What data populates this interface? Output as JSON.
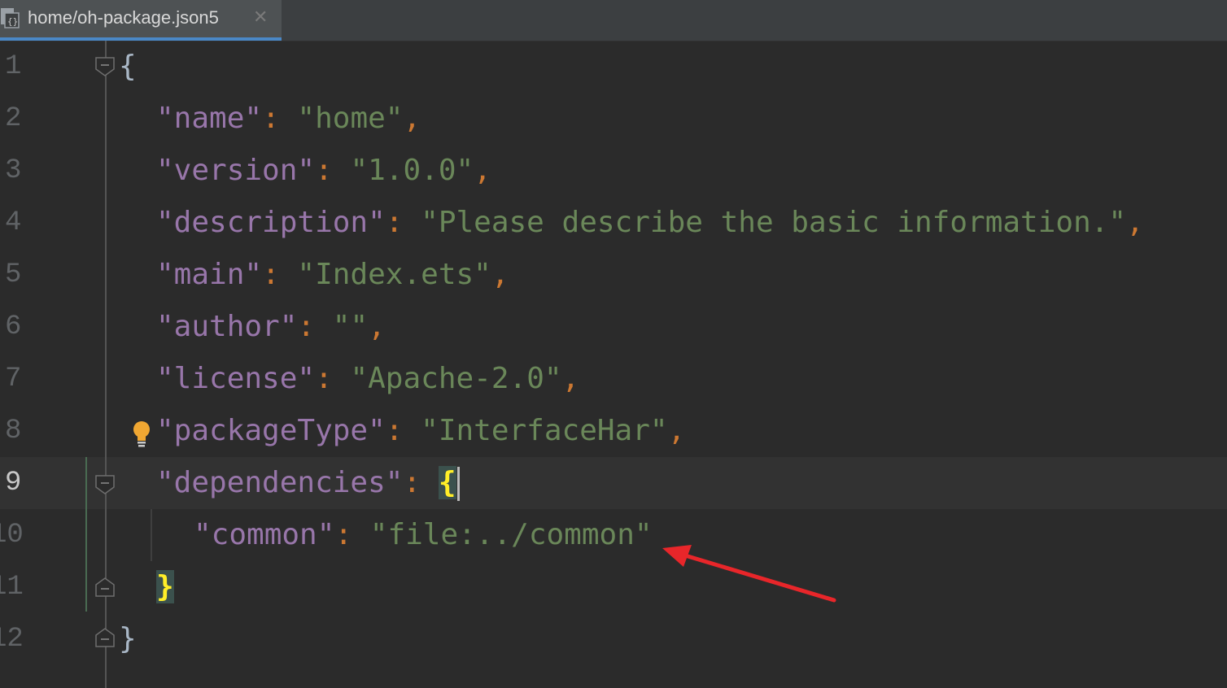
{
  "tab": {
    "title": "home/oh-package.json5",
    "close_glyph": "✕",
    "icon": "json-file-icon"
  },
  "gutter": {
    "line_numbers": [
      "1",
      "2",
      "3",
      "4",
      "5",
      "6",
      "7",
      "8",
      "9",
      "10",
      "11",
      "12"
    ],
    "active_line": "9"
  },
  "code": {
    "line1": {
      "brace": "{"
    },
    "line2": {
      "key": "\"name\"",
      "colon": ":",
      "value": "\"home\"",
      "comma": ","
    },
    "line3": {
      "key": "\"version\"",
      "colon": ":",
      "value": "\"1.0.0\"",
      "comma": ","
    },
    "line4": {
      "key": "\"description\"",
      "colon": ":",
      "value": "\"Please describe the basic information.\"",
      "comma": ","
    },
    "line5": {
      "key": "\"main\"",
      "colon": ":",
      "value": "\"Index.ets\"",
      "comma": ","
    },
    "line6": {
      "key": "\"author\"",
      "colon": ":",
      "value": "\"\"",
      "comma": ","
    },
    "line7": {
      "key": "\"license\"",
      "colon": ":",
      "value": "\"Apache-2.0\"",
      "comma": ","
    },
    "line8": {
      "key": "\"packageType\"",
      "colon": ":",
      "value": "\"InterfaceHar\"",
      "comma": ","
    },
    "line9": {
      "key": "\"dependencies\"",
      "colon": ":",
      "brace": "{"
    },
    "line10": {
      "key": "\"common\"",
      "colon": ":",
      "value": "\"file:../common\""
    },
    "line11": {
      "brace": "}"
    },
    "line12": {
      "brace": "}"
    }
  },
  "colors": {
    "background": "#2b2b2b",
    "key": "#9876aa",
    "string": "#6a8759",
    "punctuation": "#cc7832",
    "brace_match": "#ffef28",
    "annotation_arrow": "#e8262a"
  }
}
